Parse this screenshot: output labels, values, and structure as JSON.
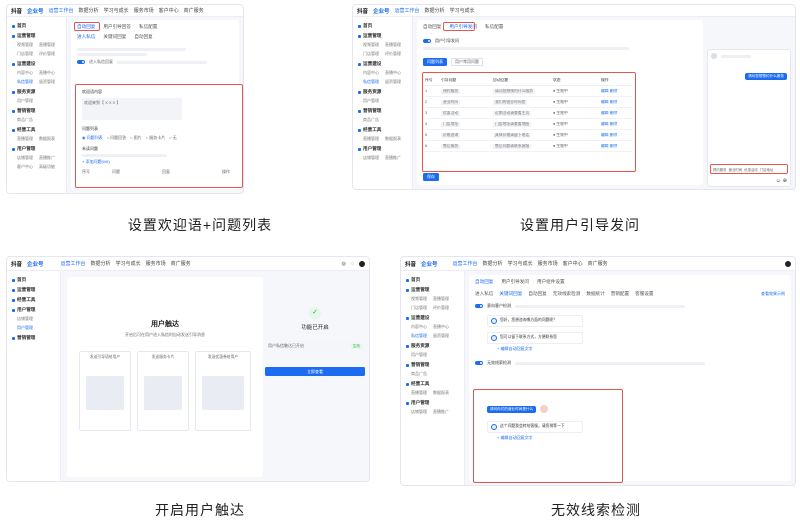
{
  "captions": {
    "p1": "设置欢迎语+问题列表",
    "p2": "设置用户引导发问",
    "p3": "开启用户触达",
    "p4": "无效线索检测"
  },
  "topbar": {
    "logo1": "抖音",
    "logo2": "企业号",
    "nav": [
      "运营工作台",
      "数据分析",
      "学习与成长",
      "服务市场",
      "客户中心",
      "商广服务"
    ]
  },
  "p3topbar": {
    "nav": [
      "运营工作台",
      "数据分析",
      "学习与成长",
      "服务市场",
      "商广服务"
    ]
  },
  "sidebar": {
    "groups": [
      {
        "label": "首页",
        "items": []
      },
      {
        "label": "运营管理",
        "items": [
          [
            "视频管理",
            "直播管理"
          ],
          [
            "门店管理",
            "评价管理"
          ]
        ]
      },
      {
        "label": "运营建设",
        "items": [
          [
            "内容中心",
            "直播中心"
          ],
          [
            "私信管理",
            "留资管理"
          ]
        ]
      },
      {
        "label": "服务资源",
        "items": [
          [
            "用户管理"
          ]
        ]
      },
      {
        "label": "营销管理",
        "items": [
          [
            "商品广告"
          ]
        ]
      },
      {
        "label": "经营工具",
        "items": [
          [
            "直播管理",
            "数据报表"
          ]
        ]
      },
      {
        "label": "用户管理",
        "items": [
          [
            "店铺管理",
            "直播推广"
          ],
          [
            "客户中心",
            "高级功能"
          ]
        ]
      }
    ]
  },
  "p1": {
    "tabs": [
      "自动回复",
      "用户引导回答",
      "私信配置"
    ],
    "subtabs": [
      "进入私信",
      "关键词回复",
      "自动回复"
    ],
    "toggle_label": "进入私信回复",
    "welcome_label": "欢迎语内容",
    "welcome_text": "欢迎来到【 X X X 】",
    "list_label": "问题列表",
    "list_options": [
      "问题列表",
      "问题回答",
      "图片",
      "服务卡片",
      "无"
    ],
    "question_label": "未读问题",
    "add_question": "+ 添加问题(0/6)",
    "cols": [
      "序号",
      "问题",
      "回复",
      "操作"
    ]
  },
  "p2": {
    "tabs": [
      "自动回复",
      "用户引导发问",
      "私信配置"
    ],
    "toggle_label": "用户引导发问",
    "btn_primary": "问题列表",
    "btn_secondary": "用户常用问题",
    "columns": [
      "序号",
      "引导问题",
      "自动回复",
      "状态",
      "操作"
    ],
    "rows": [
      [
        "1",
        "预约服务",
        "请问您想预约什么服务",
        "● 生效中",
        "编辑 删除"
      ],
      [
        "2",
        "营业时间",
        "我们的营业时间是",
        "● 生效中",
        "编辑 删除"
      ],
      [
        "3",
        "优惠活动",
        "近期活动请查看主页",
        "● 生效中",
        "编辑 删除"
      ],
      [
        "4",
        "门店地址",
        "门店地址请查看地图",
        "● 生效中",
        "编辑 删除"
      ],
      [
        "5",
        "价格咨询",
        "具体价格请留下电话",
        "● 生效中",
        "编辑 删除"
      ],
      [
        "6",
        "售后服务",
        "售后问题请联系客服",
        "● 生效中",
        "编辑 删除"
      ]
    ],
    "save": "保存",
    "chat_quick": [
      "预约服务",
      "营业时间",
      "优惠活动",
      "门店地址"
    ]
  },
  "p3": {
    "title": "用户触达",
    "subtitle": "开启后可在用户进入私信时自动发送引导消息",
    "cards": [
      "发送引导语给用户",
      "发送服务卡片",
      "发送优惠券给用户"
    ],
    "done_title": "功能已开启",
    "done_row": "用户私信触达已开启",
    "badge": "生效",
    "button": "立即查看"
  },
  "p4": {
    "tabs": [
      "自动回复",
      "用户引导发问",
      "用户组件设置"
    ],
    "subtabs": [
      "进入私信",
      "关键词回复",
      "自动回复",
      "无效线索检测",
      "数据统计",
      "营销配置",
      "客服设置"
    ],
    "link": "查看效果示例",
    "toggle1": "意向客户检测",
    "toggle2": "无效线索检测",
    "qa1": "您好，您想咨询哪方面的问题呢？",
    "qa2": "您可以留下联系方式，方便联系您",
    "qa3": "这个问题我会转给客服，请您稍等一下",
    "bubble": "请问你们的营业时间是什么",
    "link2": "+ 编辑自动回复文字"
  }
}
